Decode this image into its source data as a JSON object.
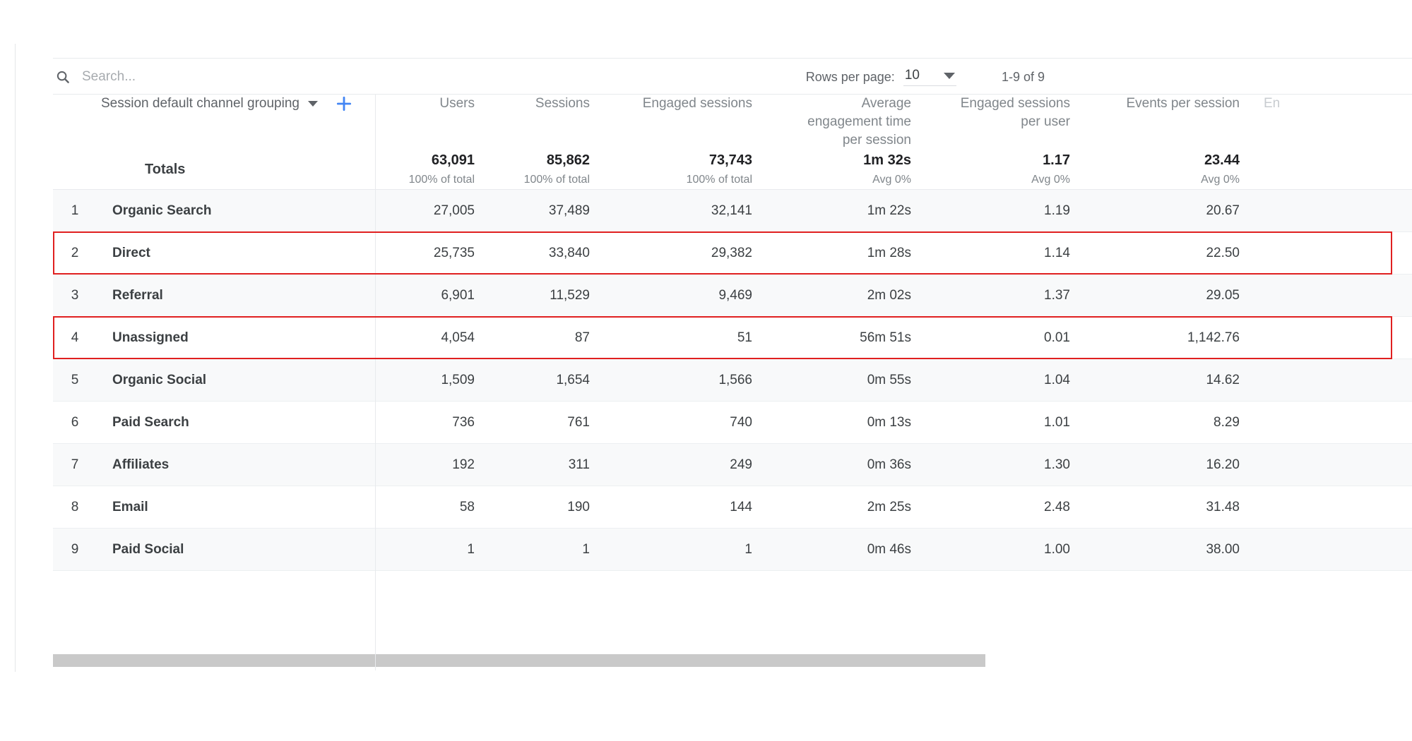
{
  "search": {
    "placeholder": "Search...",
    "value": "",
    "icon": "search-icon"
  },
  "pagination": {
    "rows_per_page_label": "Rows per page:",
    "rows_per_page_value": "10",
    "range_label": "1-9 of 9",
    "caret_icon": "chevron-down-icon"
  },
  "dimension": {
    "label": "Session default channel grouping",
    "caret_icon": "chevron-down-icon",
    "add_icon": "plus-icon"
  },
  "colors": {
    "accent": "#4285f4",
    "highlight": "#e02020",
    "header_text": "#80868b",
    "body_text": "#3c4043",
    "alt_row": "#f8f9fa"
  },
  "chart_data": {
    "type": "table",
    "title": "Session default channel grouping",
    "columns": [
      "Users",
      "Sessions",
      "Engaged sessions",
      "Average engagement time per session",
      "Engaged sessions per user",
      "Events per session",
      "En"
    ],
    "column_lines": [
      [
        "Users"
      ],
      [
        "Sessions"
      ],
      [
        "Engaged sessions"
      ],
      [
        "Average",
        "engagement time",
        "per session"
      ],
      [
        "Engaged sessions",
        "per user"
      ],
      [
        "Events per session"
      ],
      [
        "En"
      ]
    ],
    "totals": {
      "label": "Totals",
      "values": [
        "63,091",
        "85,862",
        "73,743",
        "1m 32s",
        "1.17",
        "23.44"
      ],
      "subvalues": [
        "100% of total",
        "100% of total",
        "100% of total",
        "Avg 0%",
        "Avg 0%",
        "Avg 0%"
      ]
    },
    "rows": [
      {
        "index": "1",
        "name": "Organic Search",
        "values": [
          "27,005",
          "37,489",
          "32,141",
          "1m 22s",
          "1.19",
          "20.67"
        ],
        "highlighted": false
      },
      {
        "index": "2",
        "name": "Direct",
        "values": [
          "25,735",
          "33,840",
          "29,382",
          "1m 28s",
          "1.14",
          "22.50"
        ],
        "highlighted": true
      },
      {
        "index": "3",
        "name": "Referral",
        "values": [
          "6,901",
          "11,529",
          "9,469",
          "2m 02s",
          "1.37",
          "29.05"
        ],
        "highlighted": false
      },
      {
        "index": "4",
        "name": "Unassigned",
        "values": [
          "4,054",
          "87",
          "51",
          "56m 51s",
          "0.01",
          "1,142.76"
        ],
        "highlighted": true
      },
      {
        "index": "5",
        "name": "Organic Social",
        "values": [
          "1,509",
          "1,654",
          "1,566",
          "0m 55s",
          "1.04",
          "14.62"
        ],
        "highlighted": false
      },
      {
        "index": "6",
        "name": "Paid Search",
        "values": [
          "736",
          "761",
          "740",
          "0m 13s",
          "1.01",
          "8.29"
        ],
        "highlighted": false
      },
      {
        "index": "7",
        "name": "Affiliates",
        "values": [
          "192",
          "311",
          "249",
          "0m 36s",
          "1.30",
          "16.20"
        ],
        "highlighted": false
      },
      {
        "index": "8",
        "name": "Email",
        "values": [
          "58",
          "190",
          "144",
          "2m 25s",
          "2.48",
          "31.48"
        ],
        "highlighted": false
      },
      {
        "index": "9",
        "name": "Paid Social",
        "values": [
          "1",
          "1",
          "1",
          "0m 46s",
          "1.00",
          "38.00"
        ],
        "highlighted": false
      }
    ]
  }
}
